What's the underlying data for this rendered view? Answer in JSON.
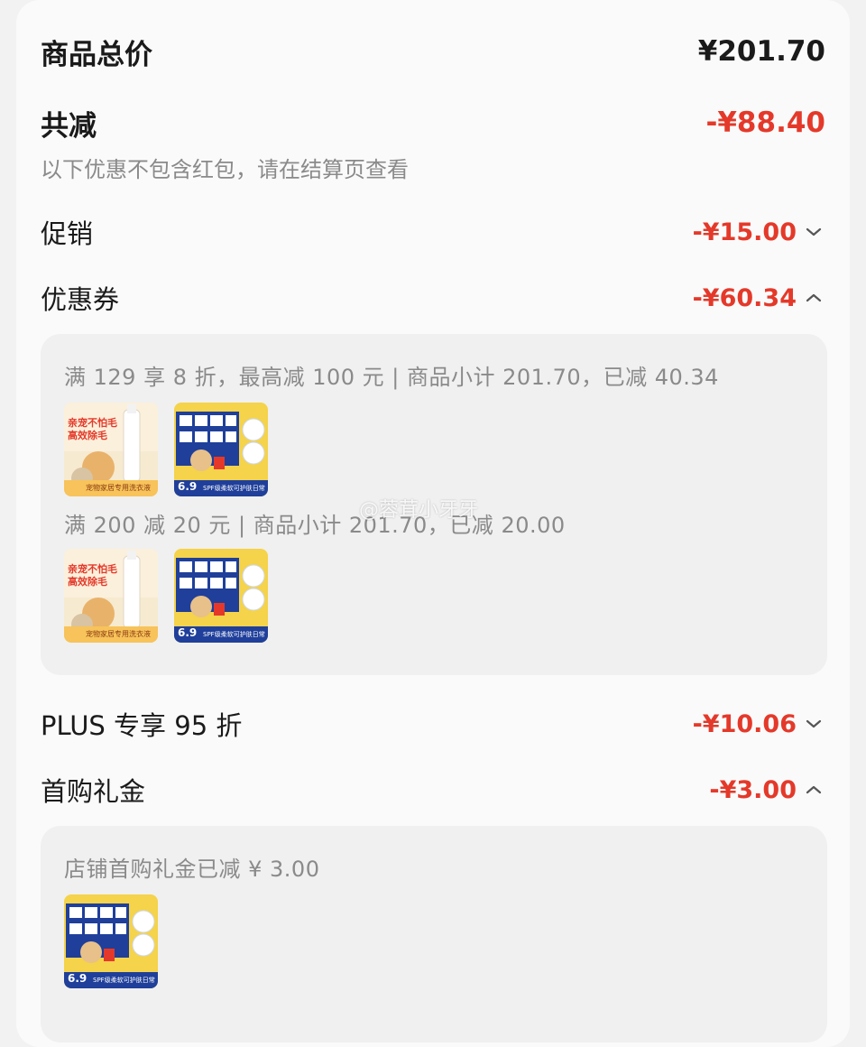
{
  "summary": {
    "total_label": "商品总价",
    "total_value": "¥201.70",
    "discount_label": "共减",
    "discount_value": "-¥88.40",
    "note": "以下优惠不包含红包，请在结算页查看"
  },
  "items": [
    {
      "label": "促销",
      "value": "-¥15.00",
      "chevron": "down"
    },
    {
      "label": "优惠券",
      "value": "-¥60.34",
      "chevron": "up"
    },
    {
      "label": "PLUS 专享 95 折",
      "value": "-¥10.06",
      "chevron": "down"
    },
    {
      "label": "首购礼金",
      "value": "-¥3.00",
      "chevron": "up"
    }
  ],
  "coupon_panel": {
    "rules": [
      "满 129 享 8 折，最高减 100 元 | 商品小计 201.70，已减 40.34",
      "满 200 减 20 元 | 商品小计 201.70，已减 20.00"
    ]
  },
  "gift_panel": {
    "rule": "店铺首购礼金已减 ¥ 3.00"
  },
  "products": {
    "detergent": {
      "line1": "亲宠不怕毛",
      "line2": "高效除毛",
      "footer": "宠物家居专用洗衣液"
    },
    "tissue": {
      "badge": "6.9",
      "footer": "SPF级柔软可护肤日常"
    }
  },
  "watermark": "@蓉茸小牙牙",
  "colors": {
    "accent": "#e4392a",
    "panel": "#f0f0f0",
    "muted": "#8a8a8a"
  }
}
